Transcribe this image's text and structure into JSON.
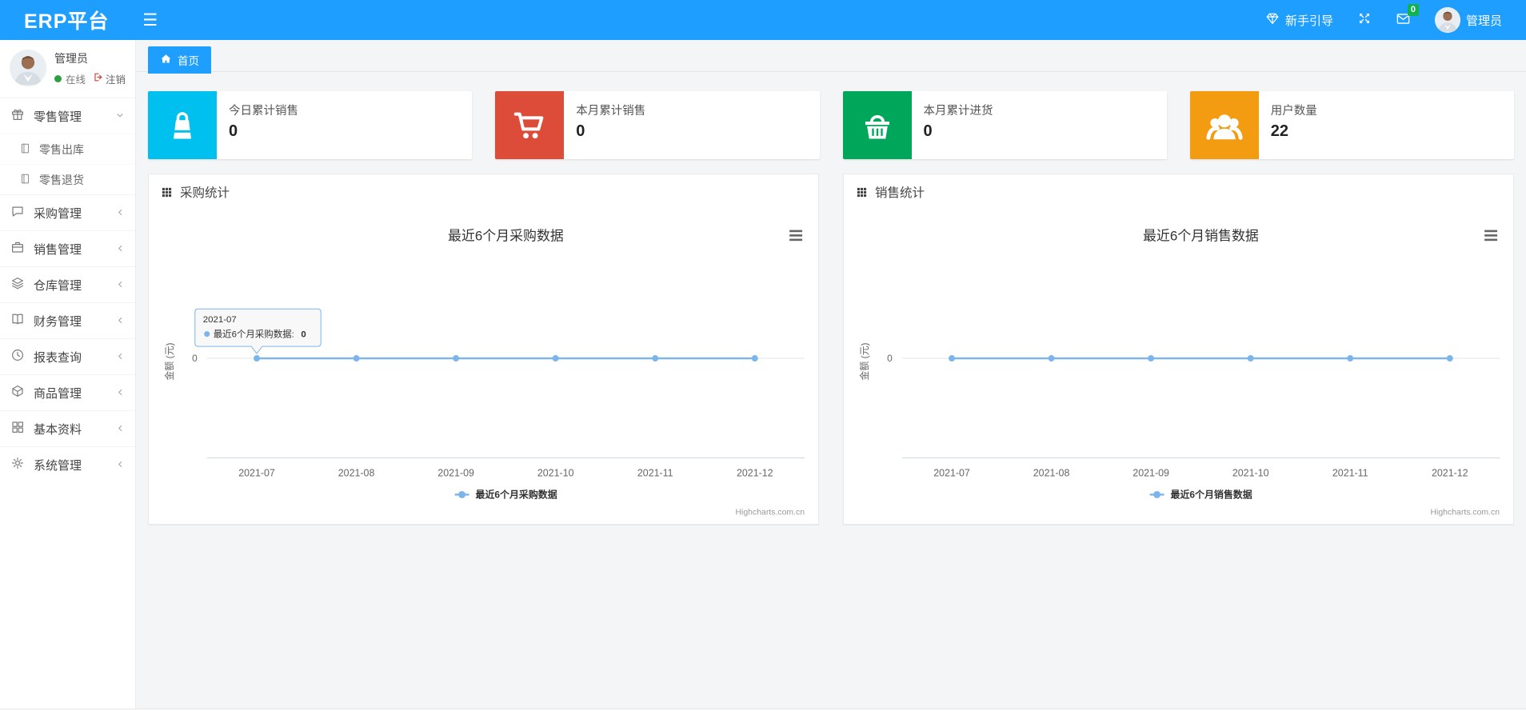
{
  "navbar": {
    "brand": "ERP平台",
    "guide_label": "新手引导",
    "message_badge": "0",
    "username": "管理员",
    "color": "#1E9FFF"
  },
  "sidebar": {
    "user": {
      "name": "管理员",
      "status": "在线",
      "logout_label": "注销"
    },
    "menu": [
      {
        "key": "retail",
        "label": "零售管理",
        "icon": "gift-icon",
        "state": "expanded",
        "children": [
          {
            "key": "retail-out",
            "label": "零售出库",
            "icon": "journal-icon"
          },
          {
            "key": "retail-return",
            "label": "零售退货",
            "icon": "journal-icon"
          }
        ]
      },
      {
        "key": "purchase",
        "label": "采购管理",
        "icon": "comment-icon",
        "state": "collapsed"
      },
      {
        "key": "sales",
        "label": "销售管理",
        "icon": "briefcase-icon",
        "state": "collapsed"
      },
      {
        "key": "warehouse",
        "label": "仓库管理",
        "icon": "layers-icon",
        "state": "collapsed"
      },
      {
        "key": "finance",
        "label": "财务管理",
        "icon": "book-icon",
        "state": "collapsed"
      },
      {
        "key": "report",
        "label": "报表查询",
        "icon": "clock-icon",
        "state": "collapsed"
      },
      {
        "key": "goods",
        "label": "商品管理",
        "icon": "cube-icon",
        "state": "collapsed"
      },
      {
        "key": "basic",
        "label": "基本资料",
        "icon": "th-large-icon",
        "state": "collapsed"
      },
      {
        "key": "system",
        "label": "系统管理",
        "icon": "gear-icon",
        "state": "collapsed"
      }
    ]
  },
  "breadcrumb": {
    "home_label": "首页"
  },
  "cards": [
    {
      "key": "today-sales",
      "label": "今日累计销售",
      "value": "0",
      "color": "#00c0ef",
      "icon": "bag-icon"
    },
    {
      "key": "month-sales",
      "label": "本月累计销售",
      "value": "0",
      "color": "#dd4b39",
      "icon": "cart-icon"
    },
    {
      "key": "month-purchase",
      "label": "本月累计进货",
      "value": "0",
      "color": "#00a65a",
      "icon": "basket-icon"
    },
    {
      "key": "user-count",
      "label": "用户数量",
      "value": "22",
      "color": "#f39c12",
      "icon": "users-icon"
    }
  ],
  "panels": [
    {
      "key": "purchase-stats",
      "header": "采购统计"
    },
    {
      "key": "sales-stats",
      "header": "销售统计"
    }
  ],
  "chart_data": [
    {
      "type": "line",
      "title": "最近6个月采购数据",
      "categories": [
        "2021-07",
        "2021-08",
        "2021-09",
        "2021-10",
        "2021-11",
        "2021-12"
      ],
      "series": [
        {
          "name": "最近6个月采购数据",
          "values": [
            0,
            0,
            0,
            0,
            0,
            0
          ]
        }
      ],
      "ylabel": "金额 (元)",
      "y_tick": "0",
      "grid": false,
      "legend_position": "bottom",
      "line_color": "#7cb5ec",
      "watermark": "Highcharts.com.cn",
      "tooltip": {
        "header": "2021-07",
        "series_label": "最近6个月采购数据:",
        "value": "0"
      }
    },
    {
      "type": "line",
      "title": "最近6个月销售数据",
      "categories": [
        "2021-07",
        "2021-08",
        "2021-09",
        "2021-10",
        "2021-11",
        "2021-12"
      ],
      "series": [
        {
          "name": "最近6个月销售数据",
          "values": [
            0,
            0,
            0,
            0,
            0,
            0
          ]
        }
      ],
      "ylabel": "金额 (元)",
      "y_tick": "0",
      "grid": false,
      "legend_position": "bottom",
      "line_color": "#7cb5ec",
      "watermark": "Highcharts.com.cn"
    }
  ]
}
